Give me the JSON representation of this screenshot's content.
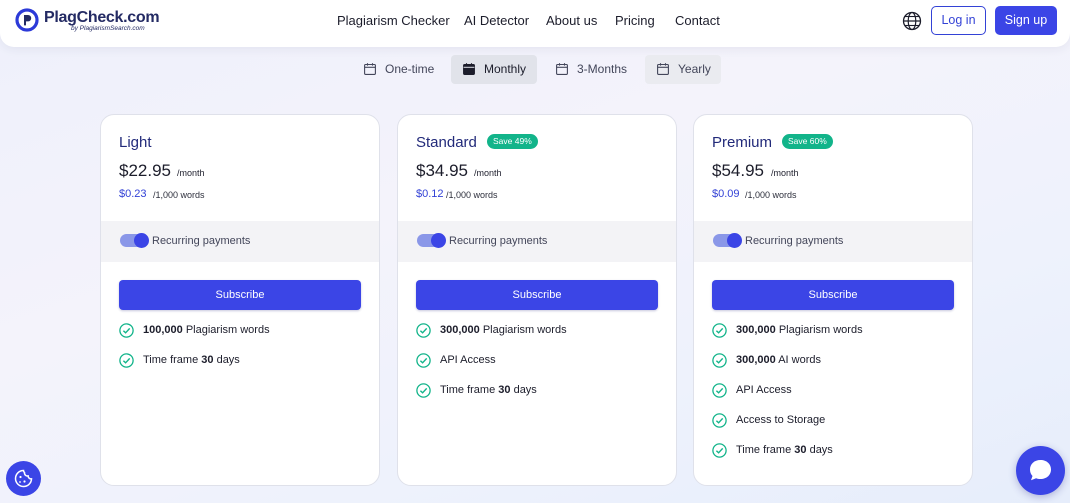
{
  "header": {
    "logo_text": "PlagCheck.com",
    "logo_sub": "by PlagiarismSearch.com",
    "nav": [
      {
        "label": "Plagiarism Checker"
      },
      {
        "label": "AI Detector"
      },
      {
        "label": "About us"
      },
      {
        "label": "Pricing"
      },
      {
        "label": "Contact"
      }
    ],
    "login_label": "Log in",
    "signup_label": "Sign up"
  },
  "periods": [
    {
      "label": "One-time",
      "state": "inactive"
    },
    {
      "label": "Monthly",
      "state": "active"
    },
    {
      "label": "3-Months",
      "state": "inactive"
    },
    {
      "label": "Yearly",
      "state": "inactive"
    }
  ],
  "plans": [
    {
      "name": "Light",
      "badge": "",
      "price": "$22.95",
      "per": "/month",
      "word_price": "$0.23",
      "word_unit": "/1,000 words",
      "recurring_label": "Recurring payments",
      "subscribe_label": "Subscribe",
      "features": [
        {
          "bold": "100,000",
          "text": " Plagiarism words"
        },
        {
          "text": "Time frame ",
          "bold_after": "30",
          "text_after": " days"
        }
      ]
    },
    {
      "name": "Standard",
      "badge": "Save 49%",
      "price": "$34.95",
      "per": "/month",
      "word_price": "$0.12",
      "word_unit": "/1,000 words",
      "recurring_label": "Recurring payments",
      "subscribe_label": "Subscribe",
      "features": [
        {
          "bold": "300,000",
          "text": " Plagiarism words"
        },
        {
          "text": "API Access"
        },
        {
          "text": "Time frame ",
          "bold_after": "30",
          "text_after": " days"
        }
      ]
    },
    {
      "name": "Premium",
      "badge": "Save 60%",
      "price": "$54.95",
      "per": "/month",
      "word_price": "$0.09",
      "word_unit": "/1,000 words",
      "recurring_label": "Recurring payments",
      "subscribe_label": "Subscribe",
      "features": [
        {
          "bold": "300,000",
          "text": " Plagiarism words"
        },
        {
          "bold": "300,000",
          "text": " AI words"
        },
        {
          "text": "API Access"
        },
        {
          "text": "Access to Storage"
        },
        {
          "text": "Time frame ",
          "bold_after": "30",
          "text_after": " days"
        }
      ]
    }
  ],
  "colors": {
    "accent": "#3b45e6",
    "check": "#12b48a",
    "plan_title": "#222a7a"
  },
  "icons": {
    "logo": "plagcheck-logo-icon",
    "globe": "globe-icon",
    "calendar": "calendar-icon",
    "check": "check-circle-icon",
    "cookie": "cookie-icon",
    "chat": "chat-bubble-icon"
  }
}
